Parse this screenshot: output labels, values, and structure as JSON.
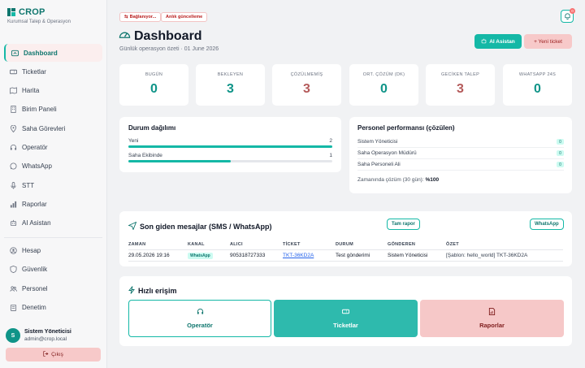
{
  "sidebar": {
    "brand": "CROP",
    "brand_sub": "Kurumsal Talep & Operasyon",
    "items": [
      {
        "label": "Dashboard",
        "icon": "dashboard-icon",
        "active": true
      },
      {
        "label": "Ticketlar",
        "icon": "ticket-icon"
      },
      {
        "label": "Harita",
        "icon": "map-icon"
      },
      {
        "label": "Birim Paneli",
        "icon": "building-icon"
      },
      {
        "label": "Saha Görevleri",
        "icon": "location-pin-icon"
      },
      {
        "label": "Operatör",
        "icon": "headset-icon"
      },
      {
        "label": "WhatsApp",
        "icon": "whatsapp-icon"
      },
      {
        "label": "STT",
        "icon": "microphone-icon"
      },
      {
        "label": "Raporlar",
        "icon": "bar-chart-icon"
      },
      {
        "label": "AI Asistan",
        "icon": "robot-icon"
      }
    ],
    "items2": [
      {
        "label": "Hesap",
        "icon": "user-circle-icon"
      },
      {
        "label": "Güvenlik",
        "icon": "shield-icon"
      },
      {
        "label": "Personel",
        "icon": "users-icon"
      },
      {
        "label": "Denetim",
        "icon": "clipboard-icon"
      }
    ],
    "user": {
      "initial": "S",
      "name": "Sistem Yöneticisi",
      "email": "admin@crop.local"
    },
    "logout_label": "Çıkış"
  },
  "topbar": {
    "chip_connecting": "Bağlanıyor...",
    "chip_live": "Anlık güncelleme",
    "notif_count": "0"
  },
  "header": {
    "title": "Dashboard",
    "subtitle": "Günlük operasyon özeti · 01 June 2026",
    "ai_button": "AI Asistan",
    "new_ticket_button": "+ Yeni ticket"
  },
  "stats": [
    {
      "label": "BUGÜN",
      "value": "0",
      "color": "#0f9488"
    },
    {
      "label": "BEKLEYEN",
      "value": "3",
      "color": "#0f9488"
    },
    {
      "label": "ÇÖZÜLMEMİŞ",
      "value": "3",
      "color": "#b45a5a"
    },
    {
      "label": "ORT. ÇÖZÜM (DK)",
      "value": "0",
      "color": "#0f9488"
    },
    {
      "label": "GECİKEN TALEP",
      "value": "3",
      "color": "#b45a5a"
    },
    {
      "label": "WHATSAPP 24S",
      "value": "0",
      "color": "#0f9488"
    }
  ],
  "status_dist": {
    "title": "Durum dağılımı",
    "rows": [
      {
        "label": "Yeni",
        "value": "2",
        "fraction": 1.0
      },
      {
        "label": "Saha Ekibinde",
        "value": "1",
        "fraction": 0.5
      }
    ]
  },
  "performance": {
    "title": "Personel performansı (çözülen)",
    "rows": [
      {
        "name": "Sistem Yöneticisi",
        "count": "0"
      },
      {
        "name": "Saha Operasyon Müdürü",
        "count": "0"
      },
      {
        "name": "Saha Personeli Ali",
        "count": "0"
      }
    ],
    "ontime_label": "Zamanında çözüm (30 gün):",
    "ontime_value": "%100"
  },
  "messages": {
    "title": "Son giden mesajlar (SMS / WhatsApp)",
    "full_report": "Tam rapor",
    "whatsapp_btn": "WhatsApp",
    "columns": [
      "ZAMAN",
      "KANAL",
      "ALICI",
      "TİCKET",
      "DURUM",
      "GÖNDEREN",
      "ÖZET"
    ],
    "rows": [
      {
        "time": "29.05.2026 19:16",
        "channel": "WhatsApp",
        "recipient": "905318727333",
        "ticket": "TKT-36KD2A",
        "status": "Test gönderimi",
        "sender": "Sistem Yöneticisi",
        "summary": "[Şablon: hello_world] TKT-36KD2A"
      }
    ]
  },
  "quick_access": {
    "title": "Hızlı erişim",
    "items": [
      {
        "label": "Operatör",
        "icon": "headset-icon"
      },
      {
        "label": "Ticketlar",
        "icon": "ticket-icon"
      },
      {
        "label": "Raporlar",
        "icon": "report-icon"
      }
    ]
  },
  "colors": {
    "accent": "#14b8a6",
    "accent_dark": "#0f766e",
    "danger_soft": "#f7c9c9",
    "danger_text": "#b45a5a"
  }
}
